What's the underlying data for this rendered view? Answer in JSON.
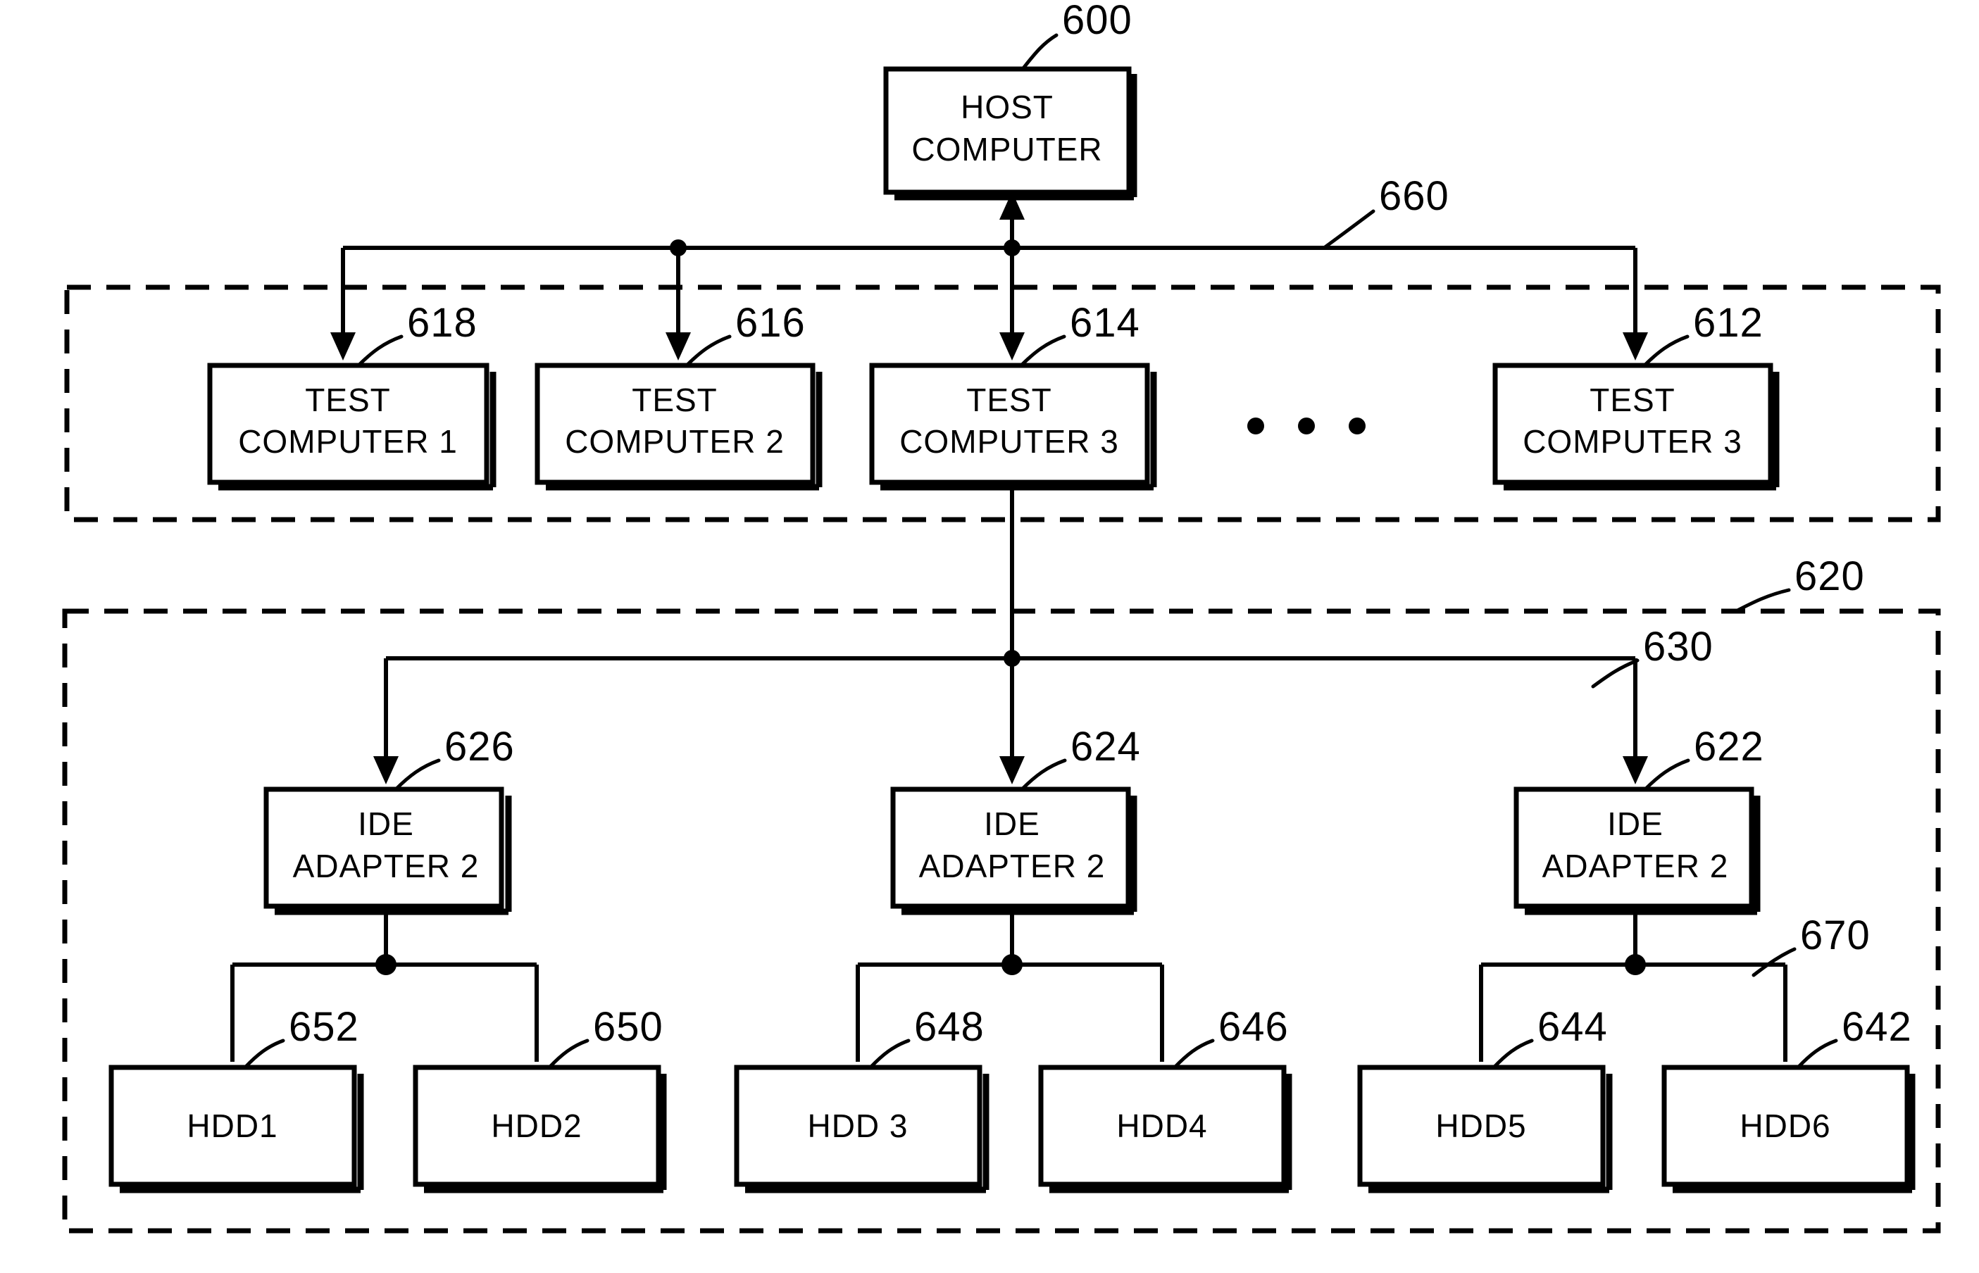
{
  "figure": {
    "title": "Test system block diagram",
    "background_color": "#ffffff",
    "line_color": "#000000"
  },
  "host": {
    "label_line1": "HOST",
    "label_line2": "COMPUTER",
    "ref": "600"
  },
  "buses": {
    "host_bus_ref": "660",
    "adapter_bus_ref": "630",
    "hdd_bus_ref": "670"
  },
  "regions": {
    "test_computer_group_ref": "",
    "adapter_group_ref": "620"
  },
  "test_computers": [
    {
      "label_line1": "TEST",
      "label_line2": "COMPUTER 1",
      "ref": "618"
    },
    {
      "label_line1": "TEST",
      "label_line2": "COMPUTER 2",
      "ref": "616"
    },
    {
      "label_line1": "TEST",
      "label_line2": "COMPUTER 3",
      "ref": "614"
    },
    {
      "label_line1": "TEST",
      "label_line2": "COMPUTER 3",
      "ref": "612"
    }
  ],
  "ellipsis": "• • •",
  "ide_adapters": [
    {
      "label_line1": "IDE",
      "label_line2": "ADAPTER 2",
      "ref": "626"
    },
    {
      "label_line1": "IDE",
      "label_line2": "ADAPTER 2",
      "ref": "624"
    },
    {
      "label_line1": "IDE",
      "label_line2": "ADAPTER 2",
      "ref": "622"
    }
  ],
  "hard_drives": [
    {
      "label": "HDD1",
      "ref": "652"
    },
    {
      "label": "HDD2",
      "ref": "650"
    },
    {
      "label": "HDD 3",
      "ref": "648"
    },
    {
      "label": "HDD4",
      "ref": "646"
    },
    {
      "label": "HDD5",
      "ref": "644"
    },
    {
      "label": "HDD6",
      "ref": "642"
    }
  ]
}
